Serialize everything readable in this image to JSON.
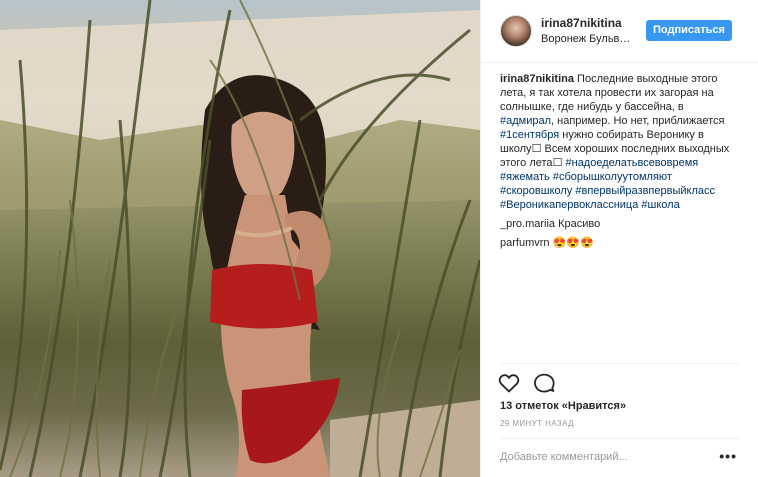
{
  "header": {
    "username": "irina87nikitina",
    "location": "Воронеж Бульв…",
    "follow_label": "Подписаться"
  },
  "caption": {
    "author": "irina87nikitina",
    "text": "Последние выходные этого лета, я так хотела провести их загорая на солнышке, где нибудь у бассейна, в",
    "tag_admiral": "#адмирал",
    "text2": ", например. Но нет, приближается",
    "tag_sept1": "#1сентября",
    "text3": " нужно собирать Веронику в школу",
    "emoji1": "☐",
    "text4": " Всем хороших последних выходных этого лета",
    "emoji2": "☐",
    "tags": [
      "#надоеделатьвсевовремя",
      "#яжемать",
      "#сборышколуутомляют",
      "#скоровшколу",
      "#впервыйразвпервыйкласс",
      "#Вероникапервоклассница",
      "#школа"
    ]
  },
  "comments": [
    {
      "author": "_pro.mariia",
      "text": "Красиво"
    },
    {
      "author": "parfumvrn",
      "text": "😍😍😍"
    }
  ],
  "likes_text": "13 отметок «Нравится»",
  "time_text": "29 МИНУТ НАЗАД",
  "comment_placeholder": "Добавьте комментарий...",
  "more_label": "•••",
  "icons": {
    "like": "heart-icon",
    "comment": "speech-bubble-icon",
    "more": "ellipsis-icon"
  },
  "colors": {
    "follow_button": "#3897f0",
    "hashtag": "#003569",
    "timestamp": "#999999"
  }
}
